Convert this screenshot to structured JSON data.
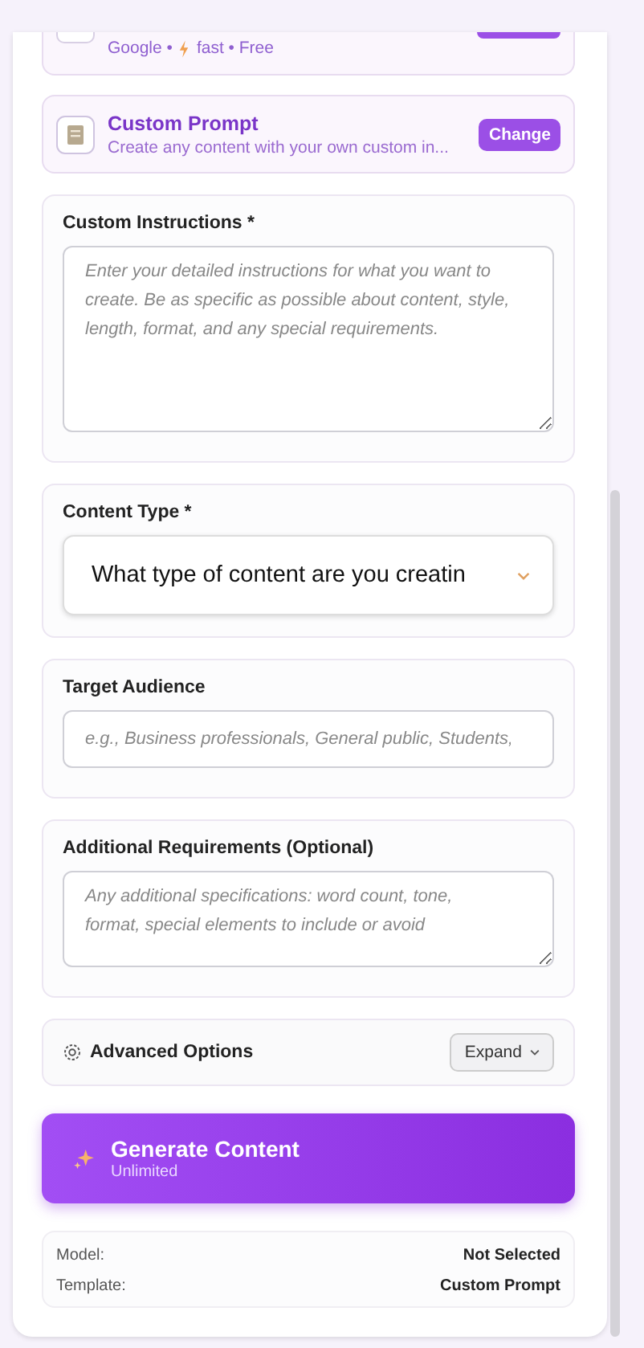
{
  "model_card": {
    "provider": "Google •",
    "speed": "fast • Free"
  },
  "template_card": {
    "title": "Custom Prompt",
    "description": "Create any content with your own custom in...",
    "button": "Change"
  },
  "fields": [
    {
      "kind": "textarea",
      "label": "Custom Instructions *",
      "placeholder": "Enter your detailed instructions for what you want to create. Be as specific as possible about content, style, length, format, and any special requirements.",
      "tall": true
    },
    {
      "kind": "select",
      "label": "Content Type *",
      "value": "What type of content are you creatin"
    },
    {
      "kind": "input",
      "label": "Target Audience",
      "placeholder": "e.g., Business professionals, General public, Students,"
    },
    {
      "kind": "textarea",
      "label": "Additional Requirements (Optional)",
      "placeholder": "Any additional specifications: word count, tone, format, special elements to include or avoid",
      "tall": false
    }
  ],
  "advanced": {
    "label": "Advanced Options",
    "button": "Expand",
    "expanded": false
  },
  "generate": {
    "title": "Generate Content",
    "subtitle": "Unlimited"
  },
  "summary": [
    {
      "label": "Model:",
      "value": "Not Selected"
    },
    {
      "label": "Template:",
      "value": "Custom Prompt"
    }
  ]
}
